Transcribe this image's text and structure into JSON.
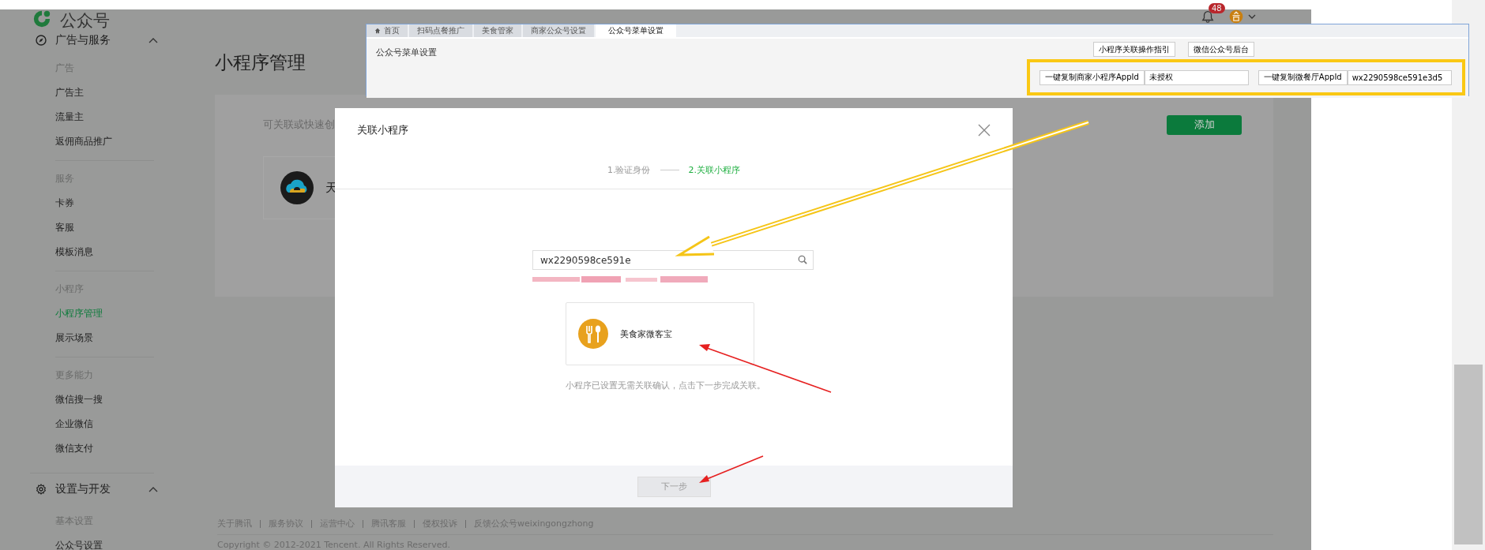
{
  "header": {
    "title": "公众号",
    "notifications": "48"
  },
  "sidebar": {
    "sections": [
      {
        "title": "广告与服务",
        "kind": "compass",
        "expanded": true,
        "groups": [
          {
            "label": "广告",
            "items": [
              {
                "label": "广告主",
                "selected": false
              },
              {
                "label": "流量主",
                "selected": false
              },
              {
                "label": "返佣商品推广",
                "selected": false
              }
            ]
          },
          {
            "label": "服务",
            "items": [
              {
                "label": "卡券",
                "selected": false
              },
              {
                "label": "客服",
                "selected": false
              },
              {
                "label": "模板消息",
                "selected": false
              }
            ]
          },
          {
            "label": "小程序",
            "items": [
              {
                "label": "小程序管理",
                "selected": true
              },
              {
                "label": "展示场景",
                "selected": false
              }
            ]
          },
          {
            "label": "更多能力",
            "items": [
              {
                "label": "微信搜一搜",
                "selected": false
              },
              {
                "label": "企业微信",
                "selected": false
              },
              {
                "label": "微信支付",
                "selected": false
              }
            ]
          }
        ]
      },
      {
        "title": "设置与开发",
        "kind": "gear",
        "expanded": true,
        "groups": [
          {
            "label": "基本设置",
            "items": [
              {
                "label": "公众号设置",
                "selected": false
              }
            ]
          }
        ]
      }
    ]
  },
  "main": {
    "title": "小程序管理",
    "description": "可关联或快速创",
    "add_button": "添加",
    "linked_app": {
      "name": "天"
    }
  },
  "footer": {
    "links": [
      "关于腾讯",
      "服务协议",
      "运营中心",
      "腾讯客服",
      "侵权投诉",
      "反馈公众号weixingongzhong"
    ],
    "copyright": "Copyright © 2012-2021 Tencent. All Rights Reserved."
  },
  "inset": {
    "tabs": [
      {
        "label": "首页",
        "selected": false
      },
      {
        "label": "扫码点餐推广",
        "selected": false
      },
      {
        "label": "美食管家",
        "selected": false
      },
      {
        "label": "商家公众号设置",
        "selected": false
      },
      {
        "label": "公众号菜单设置",
        "selected": true
      }
    ],
    "heading": "公众号菜单设置",
    "buttons": [
      "小程序关联操作指引",
      "微信公众号后台"
    ],
    "copy_rows": [
      {
        "button": "一键复制商家小程序AppId",
        "value": "未授权"
      },
      {
        "button": "一键复制微餐厅AppId",
        "value": "wx2290598ce591e3d5"
      }
    ]
  },
  "dialog": {
    "title": "关联小程序",
    "steps": [
      {
        "label": "1.验证身份",
        "selected": false
      },
      {
        "label": "2.关联小程序",
        "selected": true
      }
    ],
    "search": {
      "value": "wx2290598ce591e"
    },
    "result": {
      "name": "美食家微客宝"
    },
    "note": "小程序已设置无需关联确认，点击下一步完成关联。",
    "next_button": {
      "label": "下一步",
      "disabled": true
    }
  }
}
